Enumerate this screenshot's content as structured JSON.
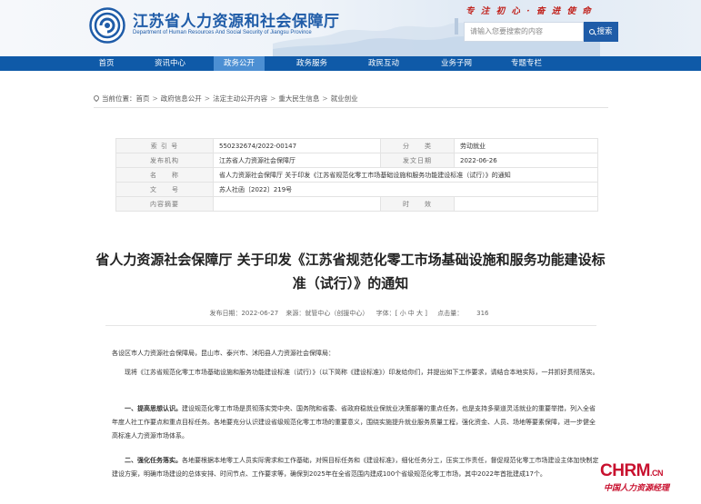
{
  "header": {
    "title": "江苏省人力资源和社会保障厅",
    "subtitle": "Department of Human Resources And Social Security of Jiangsu Province",
    "slogan": "专 注 初 心   ·   奋 进 使 命",
    "search_placeholder": "请输入您要搜索的内容",
    "search_label": "搜索",
    "accent_color": "#1f5ca8"
  },
  "nav": {
    "items": [
      "首页",
      "资讯中心",
      "政务公开",
      "政务服务",
      "政民互动",
      "业务子网",
      "专题专栏"
    ],
    "active": "政务公开"
  },
  "breadcrumb": {
    "prefix": "当前位置：",
    "items": [
      "首页",
      "政府信息公开",
      "法定主动公开内容",
      "重大民生信息",
      "就业创业"
    ]
  },
  "meta": {
    "labels": {
      "index": "索 引 号",
      "category": "分　　类",
      "agency": "发布机构",
      "date": "发文日期",
      "name": "名　　称",
      "doc_no": "文　　号",
      "summary": "内容摘要",
      "validity": "时　　效"
    },
    "values": {
      "index": "550232674/2022-00147",
      "category": "劳动就业",
      "agency": "江苏省人力资源社会保障厅",
      "date": "2022-06-26",
      "name": "省人力资源社会保障厅 关于印发《江苏省规范化零工市场基础设施和服务功能建设标准（试行）》的通知",
      "doc_no": "苏人社函〔2022〕219号",
      "summary": "",
      "validity": ""
    }
  },
  "article": {
    "title": "省人力资源社会保障厅 关于印发《江苏省规范化零工市场基础设施和服务功能建设标准（试行）》的通知",
    "publish_date": "发布日期：2022-06-27",
    "source": "来源：就管中心（创援中心）",
    "font_size": "字体：[ 小 中 大 ]",
    "views_label": "点击量：",
    "views": "316",
    "salutation": "各设区市人力资源社会保障局，昆山市、泰兴市、沭阳县人力资源社会保障局：",
    "intro": "现将《江苏省规范化零工市场基础设施和服务功能建设标准（试行）》（以下简称《建设标准》）印发给你们，并提出如下工作要求，请结合本地实际，一并抓好贯彻落实。",
    "p1_head": "一、提高思想认识。",
    "p1_body": "建设规范化零工市场是贯彻落实党中央、国务院和省委、省政府稳就业保就业决策部署的重点任务，也是支持多渠道灵活就业的重要举措，列入全省年度人社工作要点和重点目标任务。各地要充分认识建设省级规范化零工市场的重要意义，围绕实施提升就业服务质量工程，强化资金、人员、场地等要素保障，进一步健全高标准人力资源市场体系。",
    "p2_head": "二、强化任务落实。",
    "p2_body": "各地要根据本地零工人员实际需求和工作基础，对照目标任务和《建设标准》，细化任务分工，压实工作责任，督促规范化零工市场建设主体加快制定建设方案，明确市场建设的总体安排、时间节点、工作要求等，确保到2025年在全省范围内建成100个省级规范化零工市场，其中2022年首批建成17个。"
  },
  "watermark": {
    "logo": "CHRM",
    "domain": ".CN",
    "text": "中国人力资源经理"
  }
}
